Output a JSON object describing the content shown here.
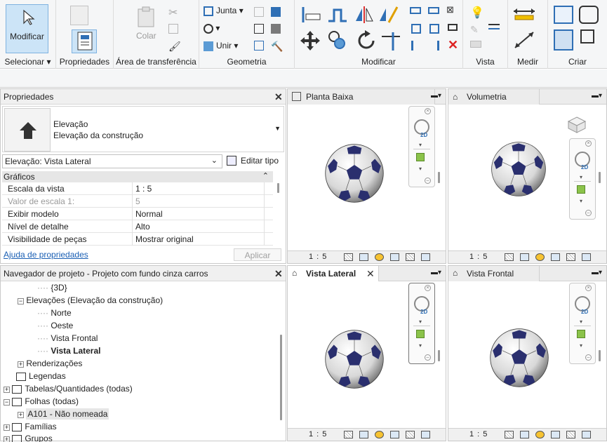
{
  "ribbon": {
    "modify_button": "Modificar",
    "groups": {
      "select": "Selecionar",
      "properties": "Propriedades",
      "clipboard": "Área de transferência",
      "geometry": "Geometria",
      "modify": "Modificar",
      "view": "Vista",
      "measure": "Medir",
      "create": "Criar"
    },
    "paste_label": "Colar",
    "join_label": "Junta",
    "union_label": "Unir"
  },
  "properties": {
    "title": "Propriedades",
    "type_name": "Elevação",
    "type_sub": "Elevação da construção",
    "selector": "Elevação: Vista Lateral",
    "edit_type": "Editar tipo",
    "section": "Gráficos",
    "rows": [
      {
        "label": "Escala da vista",
        "value": "1 : 5"
      },
      {
        "label": "Valor de escala    1:",
        "value": "5"
      },
      {
        "label": "Exibir modelo",
        "value": "Normal"
      },
      {
        "label": "Nível de detalhe",
        "value": "Alto"
      },
      {
        "label": "Visibilidade de peças",
        "value": "Mostrar original"
      }
    ],
    "help_link": "Ajuda de propriedades",
    "apply": "Aplicar"
  },
  "browser": {
    "title": "Navegador de projeto - Projeto com fundo cinza carros",
    "items": [
      {
        "label": "{3D}"
      },
      {
        "label": "Elevações (Elevação da construção)"
      },
      {
        "label": "Norte"
      },
      {
        "label": "Oeste"
      },
      {
        "label": "Vista Frontal"
      },
      {
        "label": "Vista Lateral"
      },
      {
        "label": "Renderizações"
      },
      {
        "label": "Legendas"
      },
      {
        "label": "Tabelas/Quantidades (todas)"
      },
      {
        "label": "Folhas (todas)"
      },
      {
        "label": "A101 - Não nomeada"
      },
      {
        "label": "Famílias"
      },
      {
        "label": "Grupos"
      }
    ]
  },
  "views": {
    "planta": {
      "tab": "Planta Baixa",
      "scale": "1 : 5"
    },
    "volumetria": {
      "tab": "Volumetria",
      "scale": "1 : 5"
    },
    "lateral": {
      "tab": "Vista Lateral",
      "scale": "1 : 5"
    },
    "frontal": {
      "tab": "Vista Frontal",
      "scale": "1 : 5"
    }
  },
  "colors": {
    "accent_blue": "#2f6fb5",
    "ball_patch": "#2a2f6e",
    "ribbon_bg": "#f5f6f7"
  }
}
